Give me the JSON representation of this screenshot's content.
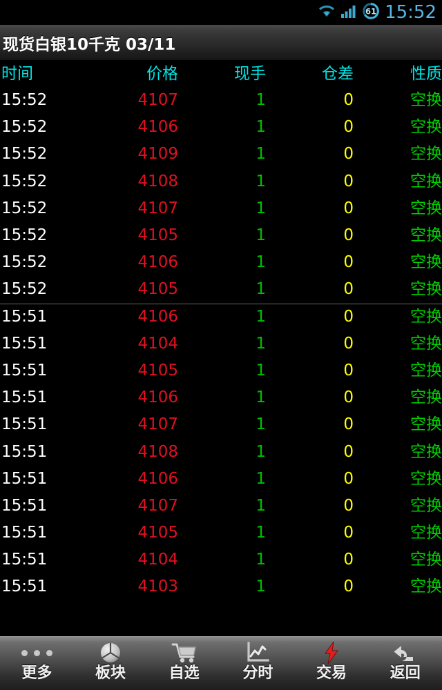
{
  "statusbar": {
    "wifi_icon": "wifi-icon",
    "signal_icon": "cellular-signal-icon",
    "battery_icon": "battery-circle-icon",
    "battery_level": "61",
    "clock": "15:52"
  },
  "titlebar": {
    "title": "现货白银10千克  03/11"
  },
  "table": {
    "columns": [
      {
        "key": "time",
        "label": "时间"
      },
      {
        "key": "price",
        "label": "价格"
      },
      {
        "key": "vol",
        "label": "现手"
      },
      {
        "key": "open",
        "label": "仓差"
      },
      {
        "key": "nature",
        "label": "性质"
      }
    ],
    "rows": [
      {
        "time": "15:52",
        "price": "4107",
        "vol": "1",
        "open": "0",
        "nature": "空换",
        "separator": false
      },
      {
        "time": "15:52",
        "price": "4106",
        "vol": "1",
        "open": "0",
        "nature": "空换",
        "separator": false
      },
      {
        "time": "15:52",
        "price": "4109",
        "vol": "1",
        "open": "0",
        "nature": "空换",
        "separator": false
      },
      {
        "time": "15:52",
        "price": "4108",
        "vol": "1",
        "open": "0",
        "nature": "空换",
        "separator": false
      },
      {
        "time": "15:52",
        "price": "4107",
        "vol": "1",
        "open": "0",
        "nature": "空换",
        "separator": false
      },
      {
        "time": "15:52",
        "price": "4105",
        "vol": "1",
        "open": "0",
        "nature": "空换",
        "separator": false
      },
      {
        "time": "15:52",
        "price": "4106",
        "vol": "1",
        "open": "0",
        "nature": "空换",
        "separator": false
      },
      {
        "time": "15:52",
        "price": "4105",
        "vol": "1",
        "open": "0",
        "nature": "空换",
        "separator": false
      },
      {
        "time": "15:51",
        "price": "4106",
        "vol": "1",
        "open": "0",
        "nature": "空换",
        "separator": true
      },
      {
        "time": "15:51",
        "price": "4104",
        "vol": "1",
        "open": "0",
        "nature": "空换",
        "separator": false
      },
      {
        "time": "15:51",
        "price": "4105",
        "vol": "1",
        "open": "0",
        "nature": "空换",
        "separator": false
      },
      {
        "time": "15:51",
        "price": "4106",
        "vol": "1",
        "open": "0",
        "nature": "空换",
        "separator": false
      },
      {
        "time": "15:51",
        "price": "4107",
        "vol": "1",
        "open": "0",
        "nature": "空换",
        "separator": false
      },
      {
        "time": "15:51",
        "price": "4108",
        "vol": "1",
        "open": "0",
        "nature": "空换",
        "separator": false
      },
      {
        "time": "15:51",
        "price": "4106",
        "vol": "1",
        "open": "0",
        "nature": "空换",
        "separator": false
      },
      {
        "time": "15:51",
        "price": "4107",
        "vol": "1",
        "open": "0",
        "nature": "空换",
        "separator": false
      },
      {
        "time": "15:51",
        "price": "4105",
        "vol": "1",
        "open": "0",
        "nature": "空换",
        "separator": false
      },
      {
        "time": "15:51",
        "price": "4104",
        "vol": "1",
        "open": "0",
        "nature": "空换",
        "separator": false
      },
      {
        "time": "15:51",
        "price": "4103",
        "vol": "1",
        "open": "0",
        "nature": "空换",
        "separator": false
      }
    ]
  },
  "navbar": {
    "items": [
      {
        "label": "更多",
        "icon": "more-dots-icon"
      },
      {
        "label": "板块",
        "icon": "sectors-pie-sphere-icon"
      },
      {
        "label": "自选",
        "icon": "watchlist-cart-icon"
      },
      {
        "label": "分时",
        "icon": "time-chart-icon"
      },
      {
        "label": "交易",
        "icon": "trade-lightning-icon"
      },
      {
        "label": "返回",
        "icon": "back-arrow-icon"
      }
    ]
  },
  "colors": {
    "accent_cyan": "#00e5e5",
    "price_red": "#e01020",
    "volume_green": "#00c000",
    "open_yellow": "#ffff00",
    "nature_green": "#00d000",
    "status_blue": "#59b6e6",
    "background": "#000000"
  }
}
